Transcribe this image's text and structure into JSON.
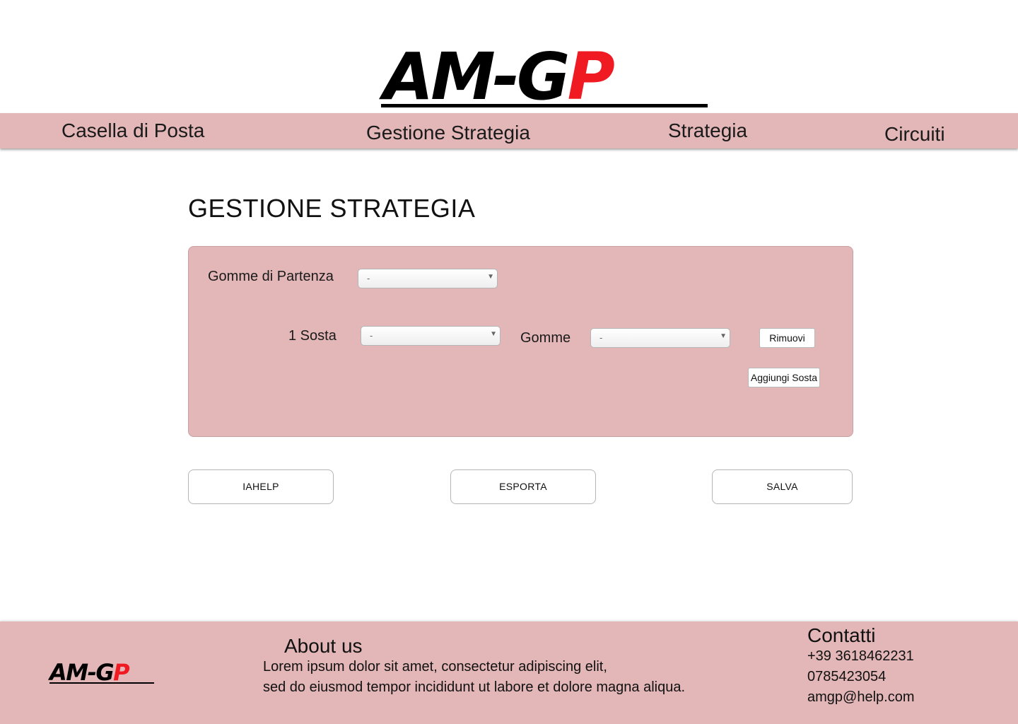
{
  "header": {
    "logo": {
      "text_black": "AM-G",
      "text_red": "P",
      "red_color": "#f01b22"
    }
  },
  "nav": {
    "items": [
      {
        "label": "Casella di Posta"
      },
      {
        "label": "Gestione Strategia"
      },
      {
        "label": "Strategia"
      },
      {
        "label": "Circuiti"
      }
    ],
    "bg_color": "#e3b6b7"
  },
  "main": {
    "title": "GESTIONE STRATEGIA",
    "form": {
      "start_tyres": {
        "label": "Gomme di Partenza",
        "value": "-"
      },
      "stops": [
        {
          "label": "1 Sosta",
          "lap_value": "-",
          "tyres_label": "Gomme",
          "tyres_value": "-",
          "remove_label": "Rimuovi"
        }
      ],
      "add_stop_label": "Aggiungi Sosta"
    },
    "actions": {
      "iahelp": "IAHELP",
      "export": "ESPORTA",
      "save": "SALVA"
    }
  },
  "footer": {
    "about": {
      "title": "About us",
      "line1": "Lorem ipsum dolor sit amet, consectetur adipiscing elit,",
      "line2": "sed do eiusmod  tempor incididunt ut labore et dolore magna aliqua."
    },
    "contacts": {
      "title": "Contatti",
      "phone1": "+39 3618462231",
      "phone2": "0785423054",
      "email": "amgp@help.com"
    }
  }
}
